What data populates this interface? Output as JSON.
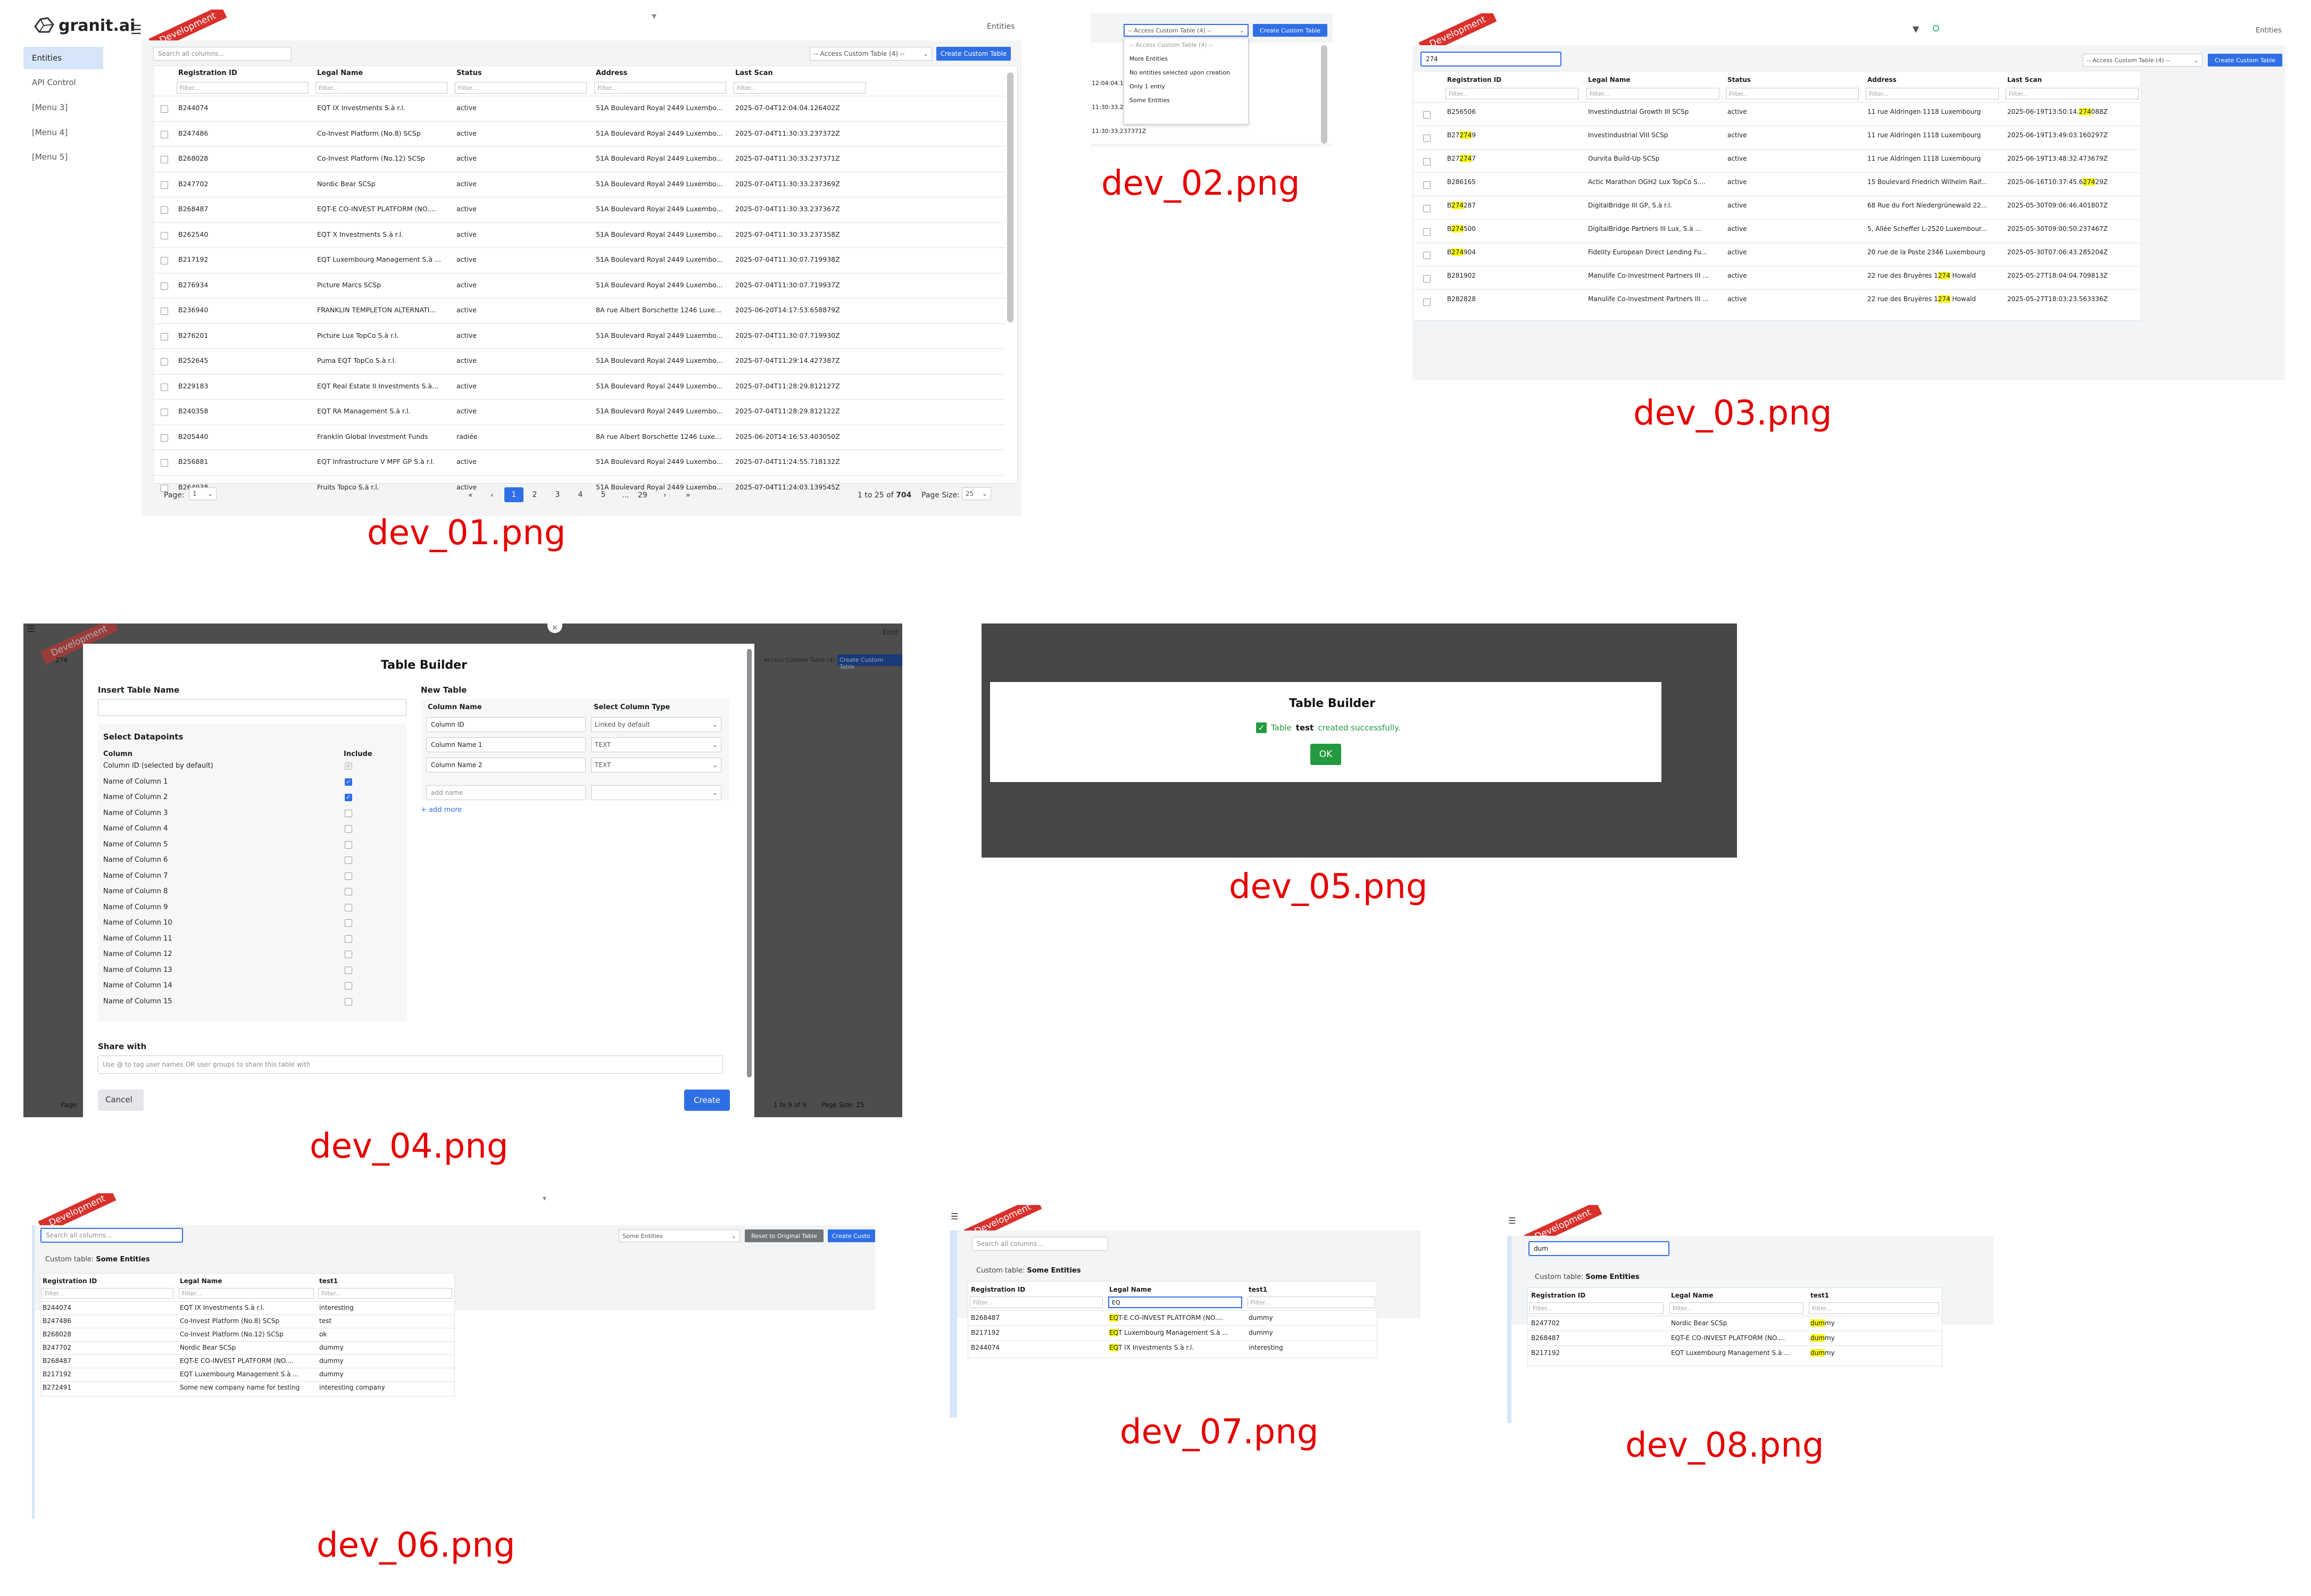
{
  "captions": {
    "dev01": "dev_01.png",
    "dev02": "dev_02.png",
    "dev03": "dev_03.png",
    "dev04": "dev_04.png",
    "dev05": "dev_05.png",
    "dev06": "dev_06.png",
    "dev07": "dev_07.png",
    "dev08": "dev_08.png"
  },
  "brand": {
    "name": "granit.ai",
    "ribbon": "Development",
    "breadcrumb": "Entities",
    "accent": "#2f6fe6",
    "ribbon_color": "#d9302c",
    "highlight": "#f7f711"
  },
  "sidebar": {
    "items": [
      {
        "label": "Entities"
      },
      {
        "label": "API Control"
      },
      {
        "label": "[Menu 3]"
      },
      {
        "label": "[Menu 4]"
      },
      {
        "label": "[Menu 5]"
      }
    ]
  },
  "toolbar": {
    "search_placeholder": "Search all columns...",
    "access_select": "-- Access Custom Table (4) --",
    "create_button": "Create Custom Table"
  },
  "columns": {
    "reg": "Registration ID",
    "legal": "Legal Name",
    "status": "Status",
    "address": "Address",
    "scan": "Last Scan",
    "filter": "Filter...",
    "test1": "test1"
  },
  "dev01": {
    "rows": [
      {
        "id": "B244074",
        "name": "EQT IX Investments S.à r.l.",
        "status": "active",
        "address": "51A Boulevard Royal 2449 Luxembo...",
        "scan": "2025-07-04T12:04:04.126402Z"
      },
      {
        "id": "B247486",
        "name": "Co-Invest Platform (No.8) SCSp",
        "status": "active",
        "address": "51A Boulevard Royal 2449 Luxembo...",
        "scan": "2025-07-04T11:30:33.237372Z"
      },
      {
        "id": "B268028",
        "name": "Co-Invest Platform (No.12) SCSp",
        "status": "active",
        "address": "51A Boulevard Royal 2449 Luxembo...",
        "scan": "2025-07-04T11:30:33.237371Z"
      },
      {
        "id": "B247702",
        "name": "Nordic Bear SCSp",
        "status": "active",
        "address": "51A Boulevard Royal 2449 Luxembo...",
        "scan": "2025-07-04T11:30:33.237369Z"
      },
      {
        "id": "B268487",
        "name": "EQT-E CO-INVEST PLATFORM (NO....",
        "status": "active",
        "address": "51A Boulevard Royal 2449 Luxembo...",
        "scan": "2025-07-04T11:30:33.237367Z"
      },
      {
        "id": "B262540",
        "name": "EQT X Investments S.à r.l.",
        "status": "active",
        "address": "51A Boulevard Royal 2449 Luxembo...",
        "scan": "2025-07-04T11:30:33.237358Z"
      },
      {
        "id": "B217192",
        "name": "EQT Luxembourg Management S.à ...",
        "status": "active",
        "address": "51A Boulevard Royal 2449 Luxembo...",
        "scan": "2025-07-04T11:30:07.719938Z"
      },
      {
        "id": "B276934",
        "name": "Picture Marcs SCSp",
        "status": "active",
        "address": "51A Boulevard Royal 2449 Luxembo...",
        "scan": "2025-07-04T11:30:07.719937Z"
      },
      {
        "id": "B236940",
        "name": "FRANKLIN TEMPLETON ALTERNATI...",
        "status": "active",
        "address": "8A rue Albert Borschette 1246 Luxe...",
        "scan": "2025-06-20T14:17:53.658879Z"
      },
      {
        "id": "B276201",
        "name": "Picture Lux TopCo S.à r.l.",
        "status": "active",
        "address": "51A Boulevard Royal 2449 Luxembo...",
        "scan": "2025-07-04T11:30:07.719930Z"
      },
      {
        "id": "B252645",
        "name": "Puma EQT TopCo S.à r.l.",
        "status": "active",
        "address": "51A Boulevard Royal 2449 Luxembo...",
        "scan": "2025-07-04T11:29:14.427387Z"
      },
      {
        "id": "B229183",
        "name": "EQT Real Estate II Investments S.à...",
        "status": "active",
        "address": "51A Boulevard Royal 2449 Luxembo...",
        "scan": "2025-07-04T11:28:29.812127Z"
      },
      {
        "id": "B240358",
        "name": "EQT RA Management S.à r.l.",
        "status": "active",
        "address": "51A Boulevard Royal 2449 Luxembo...",
        "scan": "2025-07-04T11:28:29.812122Z"
      },
      {
        "id": "B205440",
        "name": "Franklin Global Investment Funds",
        "status": "radiée",
        "address": "8A rue Albert Borschette 1246 Luxe...",
        "scan": "2025-06-20T14:16:53.403050Z"
      },
      {
        "id": "B256881",
        "name": "EQT Infrastructure V MPF GP S.à r.l.",
        "status": "active",
        "address": "51A Boulevard Royal 2449 Luxembo...",
        "scan": "2025-07-04T11:24:55.718132Z"
      },
      {
        "id": "B264938",
        "name": "Fruits Topco S.à r.l.",
        "status": "active",
        "address": "51A Boulevard Royal 2449 Luxembo...",
        "scan": "2025-07-04T11:24:03.139545Z"
      }
    ],
    "pager": {
      "page_label": "Page:",
      "page_value": "1",
      "first": "«",
      "prev": "‹",
      "pages": [
        "1",
        "2",
        "3",
        "4",
        "5"
      ],
      "ellipsis": "...",
      "last_page": "29",
      "next": "›",
      "last": "»",
      "range": "1 to 25 of",
      "total": "704",
      "size_label": "Page Size:",
      "size_value": "25"
    }
  },
  "dev02": {
    "select": "-- Access Custom Table (4) --",
    "button": "Create Custom Table",
    "options": [
      "-- Access Custom Table (4) --",
      "More Entities",
      "No entities selected upon creation",
      "Only 1 entiy",
      "Some Entities"
    ],
    "times": [
      "12:04:04.1",
      "11:30:33.2",
      "11:30:33.237371Z"
    ]
  },
  "dev03": {
    "search": "274",
    "rows": [
      {
        "id": "B256506",
        "name": "Investindustrial Growth III SCSp",
        "status": "active",
        "address": "11 rue Aldringen 1118 Luxembourg",
        "scan": "2025-06-19T13:50:14.274088Z",
        "hl": "scan"
      },
      {
        "id": "B272749",
        "name": "Investindustrial VIII SCSp",
        "status": "active",
        "address": "11 rue Aldringen 1118 Luxembourg",
        "scan": "2025-06-19T13:49:03.160297Z",
        "hl": "id"
      },
      {
        "id": "B272747",
        "name": "Ourvita Build-Up SCSp",
        "status": "active",
        "address": "11 rue Aldringen 1118 Luxembourg",
        "scan": "2025-06-19T13:48:32.473679Z",
        "hl": "id"
      },
      {
        "id": "B286165",
        "name": "Actic Marathon OGH2 Lux TopCo S....",
        "status": "active",
        "address": "15 Boulevard Friedrich Wilhelm Raif...",
        "scan": "2025-06-16T10:37:45.627429Z",
        "hl": "scan"
      },
      {
        "id": "B274287",
        "name": "DigitalBridge III GP, S.à r.l.",
        "status": "active",
        "address": "68 Rue du Fort Niedergrünewald 22...",
        "scan": "2025-05-30T09:06:46.401807Z",
        "hl": "id"
      },
      {
        "id": "B274500",
        "name": "DigitalBridge Partners III Lux, S.à ...",
        "status": "active",
        "address": "5, Allée Scheffer L-2520 Luxembour...",
        "scan": "2025-05-30T09:00:50.237467Z",
        "hl": "id"
      },
      {
        "id": "B274904",
        "name": "Fidelity European Direct Lending Fu...",
        "status": "active",
        "address": "20 rue de la Poste 2346 Luxembourg",
        "scan": "2025-05-30T07:06:43.285204Z",
        "hl": "id"
      },
      {
        "id": "B281902",
        "name": "Manulife Co-Investment Partners III ...",
        "status": "active",
        "address": "22 rue des Bruyères 1274 Howald",
        "scan": "2025-05-27T18:04:04.709813Z",
        "hl": "address"
      },
      {
        "id": "B282828",
        "name": "Manulife Co-Investment Partners III ...",
        "status": "active",
        "address": "22 rue des Bruyères 1274 Howald",
        "scan": "2025-05-27T18:03:23.563336Z",
        "hl": "address"
      }
    ]
  },
  "dev04": {
    "title": "Table Builder",
    "insert_label": "Insert Table Name",
    "datapoints_label": "Select Datapoints",
    "col_header": "Column",
    "include_header": "Include",
    "items": [
      "Column ID (selected by default)",
      "Name of Column 1",
      "Name of Column 2",
      "Name of Column 3",
      "Name of Column 4",
      "Name of Column 5",
      "Name of Column 6",
      "Name of Column 7",
      "Name of Column 8",
      "Name of Column 9",
      "Name of Column 10",
      "Name of Column 11",
      "Name of Column 12",
      "Name of Column 13",
      "Name of Column 14",
      "Name of Column 15"
    ],
    "new_table_label": "New Table",
    "col_name_header": "Column Name",
    "col_type_header": "Select Column Type",
    "new_rows": [
      {
        "name": "Column ID",
        "type": "Linked by default"
      },
      {
        "name": "Column Name 1",
        "type": "TEXT"
      },
      {
        "name": "Column Name 2",
        "type": "TEXT"
      }
    ],
    "add_name_placeholder": "add name",
    "add_more": "+ add more",
    "share_label": "Share with",
    "share_placeholder": "Use @ to tag user names OR user groups to share this table with",
    "cancel": "Cancel",
    "create": "Create",
    "bg": {
      "id_snip": "274",
      "create_btn": "Create Custom Table",
      "breadcrumb": "Entit",
      "select": "-- Access Custom Table (4) --",
      "page_label": "Page:",
      "range": "1 to 9 of 9",
      "size_label": "Page Size: 25"
    }
  },
  "dev05": {
    "title": "Table Builder",
    "msg_pre": "Table",
    "msg_name": "test",
    "msg_post": "created successfully.",
    "ok": "OK"
  },
  "dev06": {
    "search_placeholder": "Search all columns...",
    "select": "Some Entities",
    "reset": "Reset to Original Table",
    "create": "Create Custo",
    "label": "Custom table:",
    "table_name": "Some Entities",
    "rows": [
      {
        "id": "B244074",
        "name": "EQT IX Investments S.à r.l.",
        "t": "interesting"
      },
      {
        "id": "B247486",
        "name": "Co-Invest Platform (No.8) SCSp",
        "t": "test"
      },
      {
        "id": "B268028",
        "name": "Co-Invest Platform (No.12) SCSp",
        "t": "ok"
      },
      {
        "id": "B247702",
        "name": "Nordic Bear SCSp",
        "t": "dummy"
      },
      {
        "id": "B268487",
        "name": "EQT-E CO-INVEST PLATFORM (NO....",
        "t": "dummy"
      },
      {
        "id": "B217192",
        "name": "EQT Luxembourg Management S.à ...",
        "t": "dummy"
      },
      {
        "id": "B272491",
        "name": "Some new company name for testing",
        "t": "interesting company"
      }
    ]
  },
  "dev07": {
    "search_placeholder": "Search all columns...",
    "label": "Custom table:",
    "table_name": "Some Entities",
    "legal_filter": "EQ",
    "rows": [
      {
        "id": "B268487",
        "pre": "EQ",
        "name": "T-E CO-INVEST PLATFORM (NO....",
        "t": "dummy"
      },
      {
        "id": "B217192",
        "pre": "EQ",
        "name": "T Luxembourg Management S.à ...",
        "t": "dummy"
      },
      {
        "id": "B244074",
        "pre": "EQ",
        "name": "T IX Investments S.à r.l.",
        "t": "interesting"
      }
    ]
  },
  "dev08": {
    "search": "dum",
    "label": "Custom table:",
    "table_name": "Some Entities",
    "rows": [
      {
        "id": "B247702",
        "name": "Nordic Bear SCSp",
        "pre": "dum",
        "post": "my"
      },
      {
        "id": "B268487",
        "name": "EQT-E CO-INVEST PLATFORM (NO....",
        "pre": "dum",
        "post": "my"
      },
      {
        "id": "B217192",
        "name": "EQT Luxembourg Management S.à ...",
        "pre": "dum",
        "post": "my"
      }
    ]
  }
}
